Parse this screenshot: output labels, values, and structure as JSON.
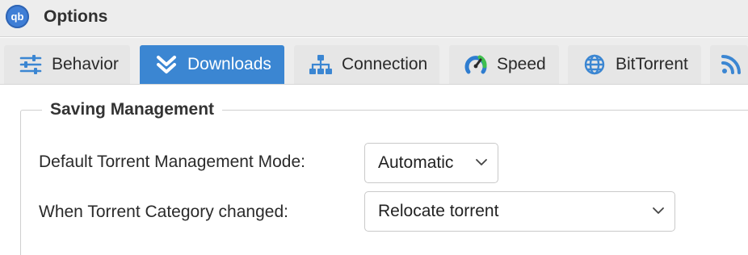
{
  "window": {
    "app_icon_text": "qb",
    "title": "Options"
  },
  "tabs": [
    {
      "label": "Behavior",
      "icon": "sliders-icon",
      "active": false
    },
    {
      "label": "Downloads",
      "icon": "double-chevron-down-icon",
      "active": true
    },
    {
      "label": "Connection",
      "icon": "network-icon",
      "active": false
    },
    {
      "label": "Speed",
      "icon": "speedometer-icon",
      "active": false
    },
    {
      "label": "BitTorrent",
      "icon": "globe-icon",
      "active": false
    },
    {
      "label": "",
      "icon": "rss-icon",
      "active": false
    }
  ],
  "saving_management": {
    "legend": "Saving Management",
    "default_mode_label": "Default Torrent Management Mode:",
    "default_mode_value": "Automatic",
    "category_changed_label": "When Torrent Category changed:",
    "category_changed_value": "Relocate torrent"
  },
  "colors": {
    "accent": "#3b86d2",
    "tab_bg": "#e6e6e6",
    "bar_bg": "#ededed"
  }
}
